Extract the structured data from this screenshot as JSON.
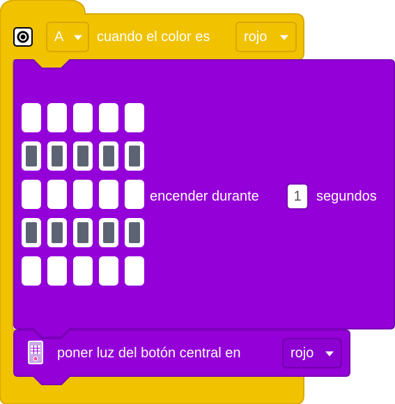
{
  "colors": {
    "events_yellow": "#f0c200",
    "events_border": "#d8a900",
    "light_purple": "#9400d8",
    "light_purple_dark": "#7a00b8",
    "pixel_on": "#5c6474",
    "pixel_off": "#ffffff"
  },
  "hat_block": {
    "sensor_icon": "color-sensor-icon",
    "port_value": "A",
    "prefix_label": "cuando el color es",
    "color_value": "rojo"
  },
  "matrix_block": {
    "grid_rows": [
      [
        false,
        false,
        false,
        false,
        false
      ],
      [
        true,
        true,
        true,
        true,
        true
      ],
      [
        false,
        false,
        false,
        false,
        false
      ],
      [
        true,
        true,
        true,
        true,
        true
      ],
      [
        false,
        false,
        false,
        false,
        false
      ]
    ],
    "label_before": "encender durante",
    "duration_value": "1",
    "label_after": "segundos"
  },
  "center_button_block": {
    "icon": "hub-center-button-icon",
    "label": "poner luz del botón central en",
    "color_value": "rojo"
  }
}
